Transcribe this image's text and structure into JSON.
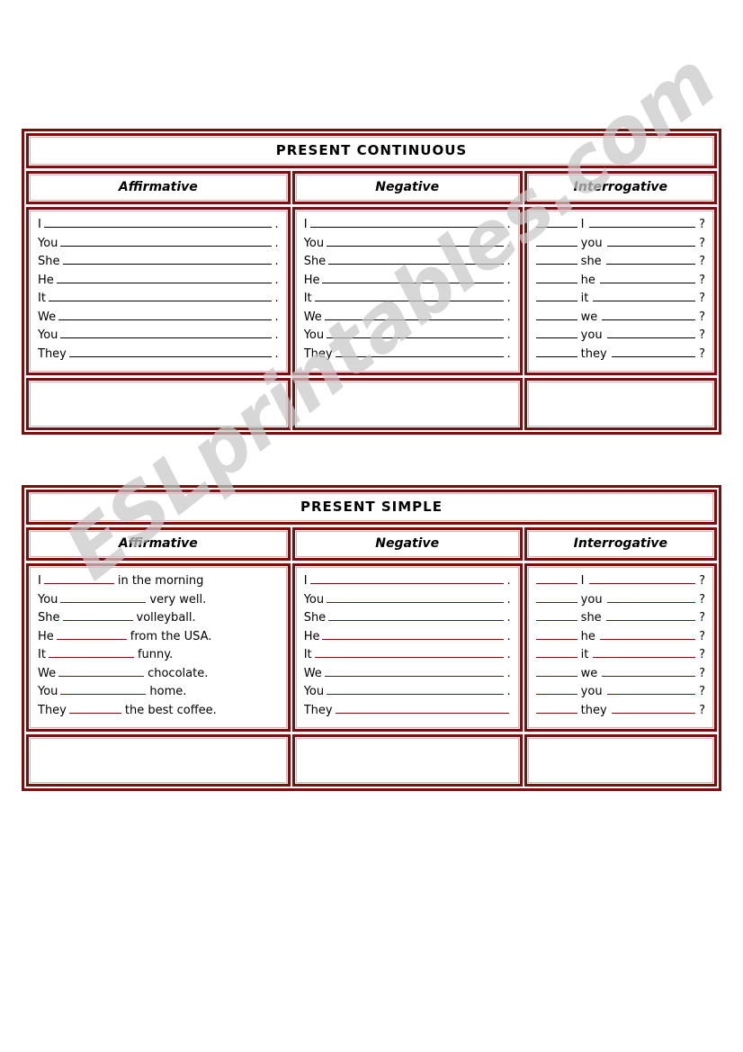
{
  "page": {
    "watermark": "ESLprintables.com",
    "background_color": "#ffffff",
    "border_color": "#7a0f0f",
    "inner_border_color": "#d8b5b5"
  },
  "worksheets": [
    {
      "id": "present-continuous",
      "title": "PRESENT CONTINUOUS",
      "line_color": "#000000",
      "columns": [
        {
          "header": "Affirmative",
          "lines": [
            {
              "subject": "I",
              "tail": "",
              "end": "."
            },
            {
              "subject": "You",
              "tail": "",
              "end": "."
            },
            {
              "subject": "She",
              "tail": "",
              "end": "."
            },
            {
              "subject": "He",
              "tail": "",
              "end": "."
            },
            {
              "subject": "It",
              "tail": "",
              "end": "."
            },
            {
              "subject": "We",
              "tail": "",
              "end": "."
            },
            {
              "subject": "You",
              "tail": "",
              "end": "."
            },
            {
              "subject": "They",
              "tail": "",
              "end": "."
            }
          ]
        },
        {
          "header": "Negative",
          "lines": [
            {
              "subject": "I",
              "tail": "",
              "end": "."
            },
            {
              "subject": "You",
              "tail": "",
              "end": "."
            },
            {
              "subject": "She",
              "tail": "",
              "end": "."
            },
            {
              "subject": "He",
              "tail": "",
              "end": "."
            },
            {
              "subject": "It",
              "tail": "",
              "end": "."
            },
            {
              "subject": "We",
              "tail": "",
              "end": "."
            },
            {
              "subject": "You",
              "tail": "",
              "end": "."
            },
            {
              "subject": "They",
              "tail": "",
              "end": "."
            }
          ]
        },
        {
          "header": "Interrogative",
          "lines": [
            {
              "subject": "I",
              "tail": "",
              "end": "?"
            },
            {
              "subject": "you",
              "tail": "",
              "end": "?"
            },
            {
              "subject": "she",
              "tail": "",
              "end": "?"
            },
            {
              "subject": "he",
              "tail": "",
              "end": "?"
            },
            {
              "subject": "it",
              "tail": "",
              "end": "?"
            },
            {
              "subject": "we",
              "tail": "",
              "end": "?"
            },
            {
              "subject": "you",
              "tail": "",
              "end": "?"
            },
            {
              "subject": "they",
              "tail": "",
              "end": "?"
            }
          ]
        }
      ]
    },
    {
      "id": "present-simple",
      "title": "PRESENT SIMPLE",
      "line_color": "#7a0f0f",
      "columns": [
        {
          "header": "Affirmative",
          "lines": [
            {
              "subject": "I",
              "tail": "in the morning",
              "end": ""
            },
            {
              "subject": "You",
              "tail": "very well.",
              "end": ""
            },
            {
              "subject": "She",
              "tail": "volleyball.",
              "end": ""
            },
            {
              "subject": "He",
              "tail": "from the USA.",
              "end": ""
            },
            {
              "subject": "It",
              "tail": "funny.",
              "end": ""
            },
            {
              "subject": "We",
              "tail": "chocolate.",
              "end": ""
            },
            {
              "subject": "You",
              "tail": "home.",
              "end": ""
            },
            {
              "subject": "They",
              "tail": "the best coffee.",
              "end": ""
            }
          ]
        },
        {
          "header": "Negative",
          "lines": [
            {
              "subject": "I",
              "tail": "",
              "end": "."
            },
            {
              "subject": "You",
              "tail": "",
              "end": "."
            },
            {
              "subject": "She",
              "tail": "",
              "end": "."
            },
            {
              "subject": "He",
              "tail": "",
              "end": "."
            },
            {
              "subject": "It",
              "tail": "",
              "end": "."
            },
            {
              "subject": "We",
              "tail": "",
              "end": "."
            },
            {
              "subject": "You",
              "tail": "",
              "end": "."
            },
            {
              "subject": "They",
              "tail": "",
              "end": ""
            }
          ]
        },
        {
          "header": "Interrogative",
          "lines": [
            {
              "subject": "I",
              "tail": "",
              "end": "?"
            },
            {
              "subject": "you",
              "tail": "",
              "end": "?"
            },
            {
              "subject": "she",
              "tail": "",
              "end": "?"
            },
            {
              "subject": "he",
              "tail": "",
              "end": "?"
            },
            {
              "subject": "it",
              "tail": "",
              "end": "?"
            },
            {
              "subject": "we",
              "tail": "",
              "end": "?"
            },
            {
              "subject": "you",
              "tail": "",
              "end": "?"
            },
            {
              "subject": "they",
              "tail": "",
              "end": "?"
            }
          ]
        }
      ]
    }
  ]
}
